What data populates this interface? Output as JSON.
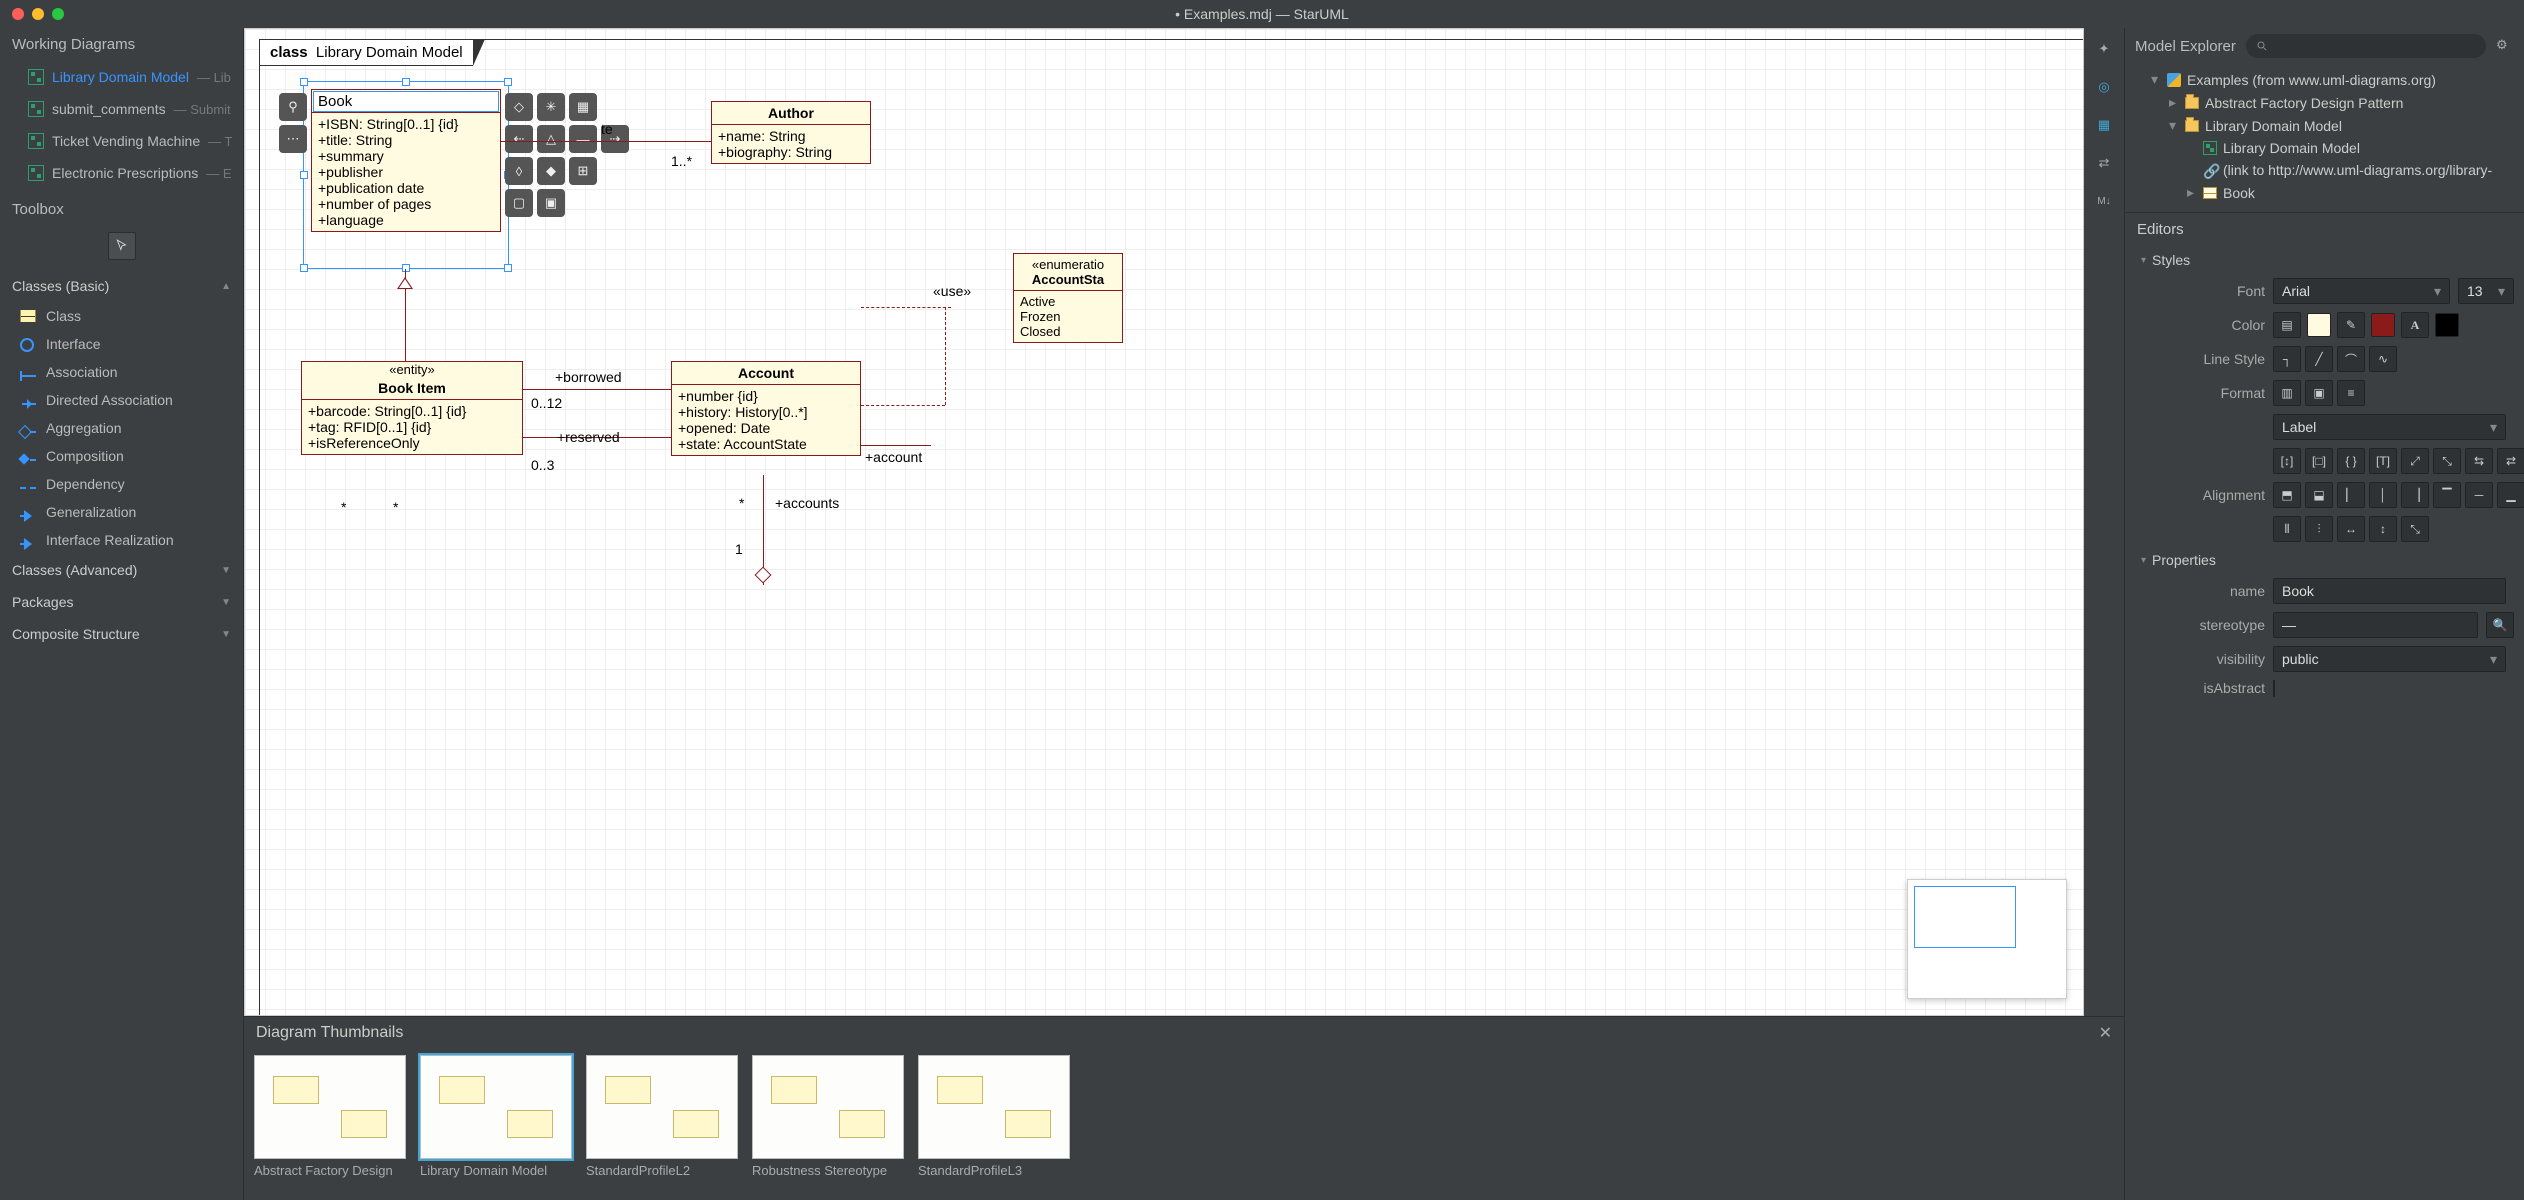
{
  "titlebar": {
    "title": "• Examples.mdj — StarUML"
  },
  "left": {
    "workingDiagramsTitle": "Working Diagrams",
    "items": [
      {
        "label": "Library Domain Model",
        "sub": " — Lib"
      },
      {
        "label": "submit_comments",
        "sub": " — Submit"
      },
      {
        "label": "Ticket Vending Machine",
        "sub": " — T"
      },
      {
        "label": "Electronic Prescriptions",
        "sub": " — E"
      }
    ],
    "toolboxTitle": "Toolbox",
    "groupBasic": "Classes (Basic)",
    "tools": [
      "Class",
      "Interface",
      "Association",
      "Directed Association",
      "Aggregation",
      "Composition",
      "Dependency",
      "Generalization",
      "Interface Realization"
    ],
    "groupsCollapsed": [
      "Classes (Advanced)",
      "Packages",
      "Composite Structure"
    ]
  },
  "canvas": {
    "frameKeyword": "class",
    "frameName": "Library Domain Model",
    "editingValue": "Book",
    "book": {
      "name": "Book",
      "attrs": [
        "+ISBN: String[0..1] {id}",
        "+title: String",
        "+summary",
        "+publisher",
        "+publication date",
        "+number of pages",
        "+language"
      ]
    },
    "author": {
      "name": "Author",
      "attrs": [
        "+name: String",
        "+biography: String"
      ]
    },
    "bookItem": {
      "stereo": "«entity»",
      "name": "Book Item",
      "attrs": [
        "+barcode: String[0..1] {id}",
        "+tag: RFID[0..1] {id}",
        "+isReferenceOnly"
      ]
    },
    "account": {
      "name": "Account",
      "attrs": [
        "+number {id}",
        "+history: History[0..*]",
        "+opened: Date",
        "+state: AccountState"
      ]
    },
    "enum": {
      "stereo": "«enumeratio",
      "name": "AccountSta",
      "items": [
        "Active",
        "Frozen",
        "Closed"
      ]
    },
    "labels": {
      "wrote": "te",
      "oneMany": "1..*",
      "borrowed": "+borrowed",
      "borrowedCard": "0..12",
      "reserved": "+reserved",
      "reservedCard": "0..3",
      "use": "«use»",
      "account": "+account",
      "accounts": "+accounts",
      "star1": "*",
      "star2": "*",
      "star3": "*",
      "one": "1"
    }
  },
  "strip": [
    "puzzle",
    "target",
    "grid",
    "share",
    "md"
  ],
  "thumbs": {
    "title": "Diagram Thumbnails",
    "items": [
      "Abstract Factory Design",
      "Library Domain Model",
      "StandardProfileL2",
      "Robustness Stereotype",
      "StandardProfileL3"
    ]
  },
  "right": {
    "explorerTitle": "Model Explorer",
    "searchPlaceholder": "",
    "tree": {
      "root": "Examples (from www.uml-diagrams.org)",
      "p1": "Abstract Factory Design Pattern",
      "p2": "Library Domain Model",
      "d1": "Library Domain Model",
      "l1": "(link to http://www.uml-diagrams.org/library-",
      "c1": "Book"
    },
    "editorsTitle": "Editors",
    "stylesTitle": "Styles",
    "fontLabel": "Font",
    "fontValue": "Arial",
    "fontSize": "13",
    "colorLabel": "Color",
    "fillColor": "#fffbe0",
    "lineColor": "#8b1a1a",
    "textColor": "#000000",
    "lineStyleLabel": "Line Style",
    "formatLabel": "Format",
    "formatSelect": "Label",
    "alignmentLabel": "Alignment",
    "propertiesTitle": "Properties",
    "nameLabel": "name",
    "nameValue": "Book",
    "stereoLabel": "stereotype",
    "stereoValue": "—",
    "visLabel": "visibility",
    "visValue": "public",
    "isAbstractLabel": "isAbstract"
  }
}
